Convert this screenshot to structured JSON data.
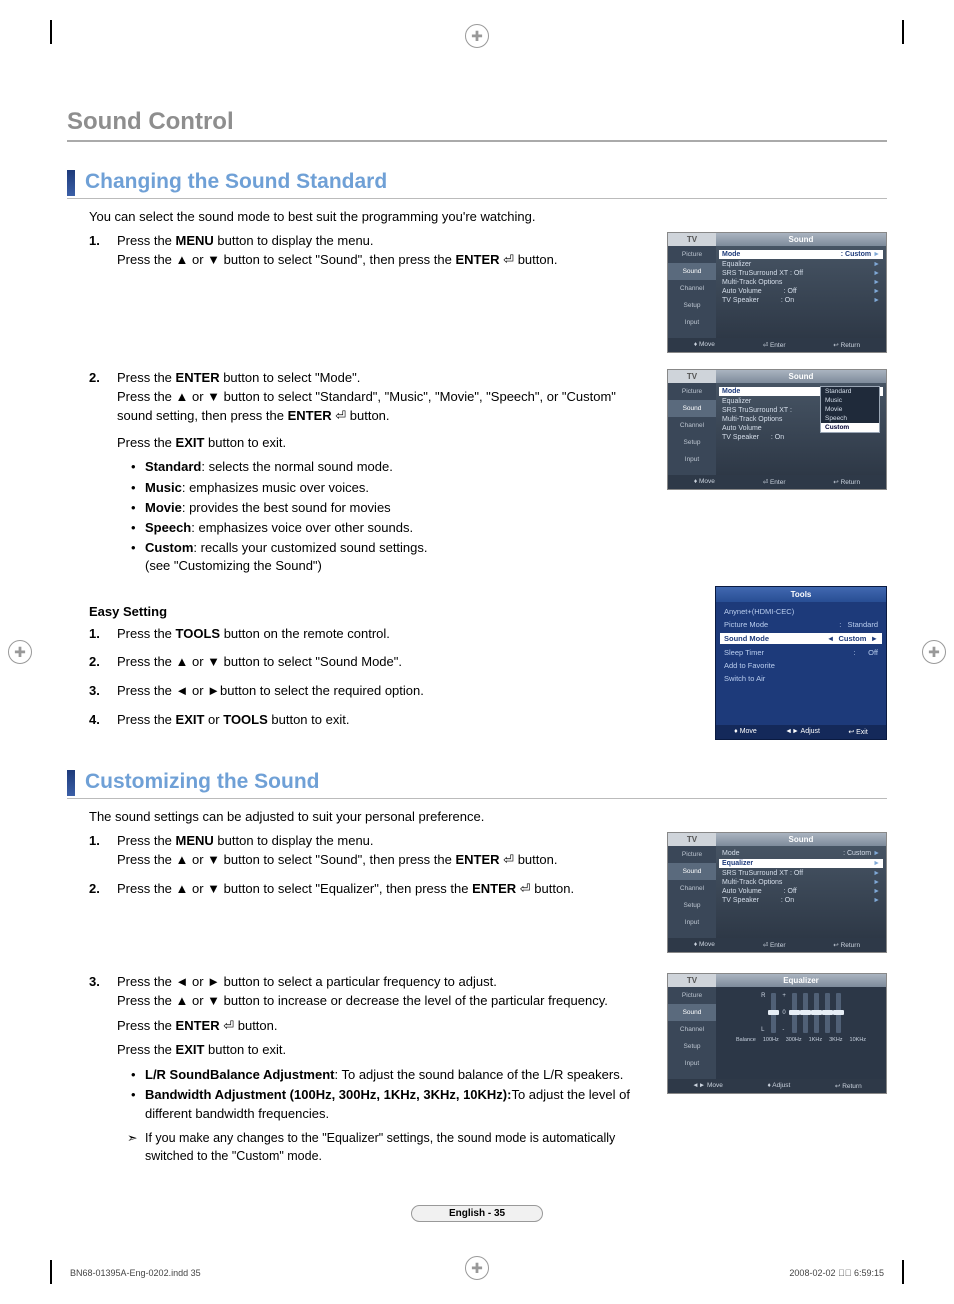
{
  "page": {
    "title": "Sound Control",
    "badge": "English - 35",
    "doc_id": "BN68-01395A-Eng-0202.indd   35",
    "timestamp": "2008-02-02   \u0000\u0000 6:59:15"
  },
  "section1": {
    "heading": "Changing the Sound Standard",
    "intro": "You can select the sound mode to best suit the programming you're watching.",
    "step1_a": "Press the ",
    "step1_menu": "MENU",
    "step1_b": " button to display the menu.",
    "step1_c": "Press the ▲ or ▼ button to select \"Sound\", then press the ",
    "step1_enter": "ENTER",
    "step1_d": " button.",
    "step2_a": "Press the ",
    "step2_enter": "ENTER",
    "step2_b": " button to select \"Mode\".",
    "step2_c": "Press the ▲ or ▼ button to select \"Standard\", \"Music\", \"Movie\", \"Speech\", or \"Custom\" sound setting, then press the ",
    "step2_enter2": "ENTER",
    "step2_d": " button.",
    "step2_exit": "Press the ",
    "step2_exit_b": "EXIT",
    "step2_exit_c": " button to exit.",
    "modes": {
      "standard": {
        "k": "Standard",
        "v": ": selects the normal sound mode."
      },
      "music": {
        "k": "Music",
        "v": ": emphasizes music over voices."
      },
      "movie": {
        "k": "Movie",
        "v": ": provides the best sound for movies"
      },
      "speech": {
        "k": "Speech",
        "v": ": emphasizes voice over other sounds."
      },
      "custom": {
        "k": "Custom",
        "v": ": recalls your customized sound settings."
      },
      "custom_note": "(see \"Customizing the Sound\")"
    },
    "easy_heading": "Easy Setting",
    "easy1": "Press the TOOLS button on the remote control.",
    "easy2": "Press the ▲ or ▼ button to select \"Sound Mode\".",
    "easy3": "Press the ◄ or ►button to select the required option.",
    "easy4": "Press the EXIT or TOOLS button to exit."
  },
  "section2": {
    "heading": "Customizing the Sound",
    "intro": "The sound settings can be adjusted to suit your personal preference.",
    "s1a": "Press the ",
    "s1menu": "MENU",
    "s1b": " button to display the menu.",
    "s1c": "Press the ▲ or ▼ button to select \"Sound\", then press the ",
    "s1enter": "ENTER",
    "s1d": " button.",
    "s2a": "Press the ▲ or ▼ button to select \"Equalizer\", then press the ",
    "s2enter": "ENTER",
    "s2b": " button.",
    "s3a": "Press the ◄ or ► button to select a particular frequency to adjust.",
    "s3b": "Press the ▲ or ▼ button to increase or decrease the level of the particular frequency.",
    "s3c": "Press the ",
    "s3enter": "ENTER",
    "s3d": " button.",
    "s3e": "Press the ",
    "s3exit": "EXIT",
    "s3f": " button to exit.",
    "b1k": "L/R SoundBalance Adjustment",
    "b1v": ": To adjust the sound balance of the L/R speakers.",
    "b2k": "Bandwidth Adjustment (100Hz, 300Hz, 1KHz, 3KHz, 10KHz):",
    "b2v": "To adjust the level of different bandwidth frequencies.",
    "note": "If you make any changes to the \"Equalizer\" settings, the sound mode is automatically switched to the \"Custom\" mode."
  },
  "osd": {
    "tv": "TV",
    "sound": "Sound",
    "equalizer_title": "Equalizer",
    "nav": {
      "picture": "Picture",
      "sound": "Sound",
      "channel": "Channel",
      "setup": "Setup",
      "input": "Input"
    },
    "menu": {
      "mode": "Mode",
      "mode_val": ": Custom",
      "eq": "Equalizer",
      "srs": "SRS TruSurround XT : Off",
      "mto": "Multi-Track Options",
      "av": "Auto Volume",
      "av_val": ": Off",
      "tvs": "TV Speaker",
      "tvs_val": ": On"
    },
    "popup": {
      "standard": "Standard",
      "music": "Music",
      "movie": "Movie",
      "speech": "Speech",
      "custom": "Custom"
    },
    "foot": {
      "move": "Move",
      "enter": "Enter",
      "return": "Return",
      "adjust": "Adjust",
      "exit": "Exit"
    },
    "tools": {
      "title": "Tools",
      "anynet": "Anynet+(HDMI-CEC)",
      "picmode": "Picture Mode",
      "picmode_v": "Standard",
      "soundmode": "Sound Mode",
      "soundmode_v": "Custom",
      "sleep": "Sleep Timer",
      "sleep_v": "Off",
      "addfav": "Add to Favorite",
      "switch": "Switch to Air"
    },
    "eq_labels": {
      "balance": "Balance",
      "f1": "100Hz",
      "f2": "300Hz",
      "f3": "1KHz",
      "f4": "3KHz",
      "f5": "10KHz",
      "r": "R",
      "l": "L"
    }
  }
}
